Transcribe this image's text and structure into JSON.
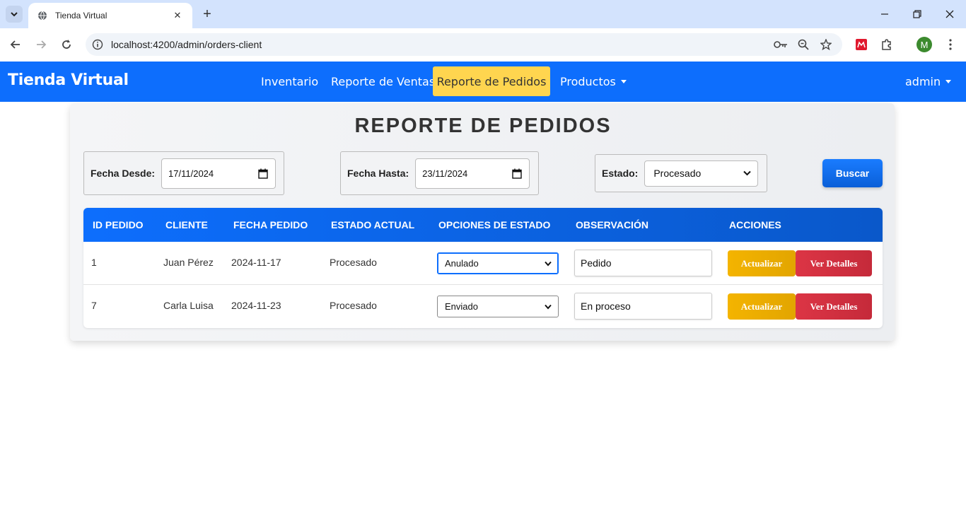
{
  "browser": {
    "tab_title": "Tienda Virtual",
    "url": "localhost:4200/admin/orders-client",
    "profile_initial": "M"
  },
  "navbar": {
    "brand": "Tienda Virtual",
    "links": [
      "Inventario",
      "Reporte de Ventas",
      "Reporte de Pedidos",
      "Productos"
    ],
    "active_link": "Reporte de Pedidos",
    "user": "admin",
    "color": "#0d6efd",
    "active_color": "#ffd54f"
  },
  "page": {
    "title": "REPORTE DE PEDIDOS"
  },
  "filters": {
    "fecha_desde_label": "Fecha Desde:",
    "fecha_desde_value": "17/11/2024",
    "fecha_hasta_label": "Fecha Hasta:",
    "fecha_hasta_value": "23/11/2024",
    "estado_label": "Estado:",
    "estado_value": "Procesado",
    "buscar_label": "Buscar"
  },
  "table": {
    "headers": [
      "ID PEDIDO",
      "CLIENTE",
      "FECHA PEDIDO",
      "ESTADO ACTUAL",
      "OPCIONES DE ESTADO",
      "OBSERVACIÓN",
      "ACCIONES"
    ],
    "rows": [
      {
        "id": "1",
        "cliente": "Juan Pérez",
        "fecha": "2024-11-17",
        "estado": "Procesado",
        "opcion": "Anulado",
        "observacion": "Pedido",
        "actualizar": "Actualizar",
        "detalles": "Ver Detalles"
      },
      {
        "id": "7",
        "cliente": "Carla Luisa",
        "fecha": "2024-11-23",
        "estado": "Procesado",
        "opcion": "Enviado",
        "observacion": "En proceso",
        "actualizar": "Actualizar",
        "detalles": "Ver Detalles"
      }
    ]
  }
}
